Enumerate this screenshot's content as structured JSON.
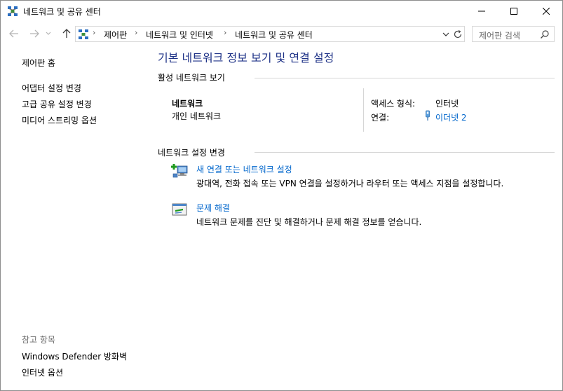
{
  "window": {
    "title": "네트워크 및 공유 센터",
    "controls": [
      "minimize",
      "maximize",
      "close"
    ]
  },
  "nav": {
    "breadcrumb": [
      "제어판",
      "네트워크 및 인터넷",
      "네트워크 및 공유 센터"
    ],
    "search_placeholder": "제어판 검색"
  },
  "sidebar": {
    "home": "제어판 홈",
    "items": [
      {
        "label": "어댑터 설정 변경"
      },
      {
        "label": "고급 공유 설정 변경"
      },
      {
        "label": "미디어 스트리밍 옵션"
      }
    ],
    "see_also_heading": "참고 항목",
    "see_also": [
      {
        "label": "Windows Defender 방화벽"
      },
      {
        "label": "인터넷 옵션"
      }
    ]
  },
  "main": {
    "title": "기본 네트워크 정보 보기 및 연결 설정",
    "active_section": "활성 네트워크 보기",
    "network": {
      "name": "네트워크",
      "type": "개인 네트워크",
      "access_type_label": "액세스 형식:",
      "access_type_value": "인터넷",
      "connections_label": "연결:",
      "connection_value": "이더넷 2"
    },
    "change_section": "네트워크 설정 변경",
    "tasks": [
      {
        "title": "새 연결 또는 네트워크 설정",
        "desc": "광대역, 전화 접속 또는 VPN 연결을 설정하거나 라우터 또는 액세스 지점을 설정합니다."
      },
      {
        "title": "문제 해결",
        "desc": "네트워크 문제를 진단 및 해결하거나 문제 해결 정보를 얻습니다."
      }
    ]
  },
  "colors": {
    "title_blue": "#1e3287",
    "link_blue": "#0066cc",
    "muted_text": "#6d6d6d",
    "divider": "#d6d6d6"
  }
}
